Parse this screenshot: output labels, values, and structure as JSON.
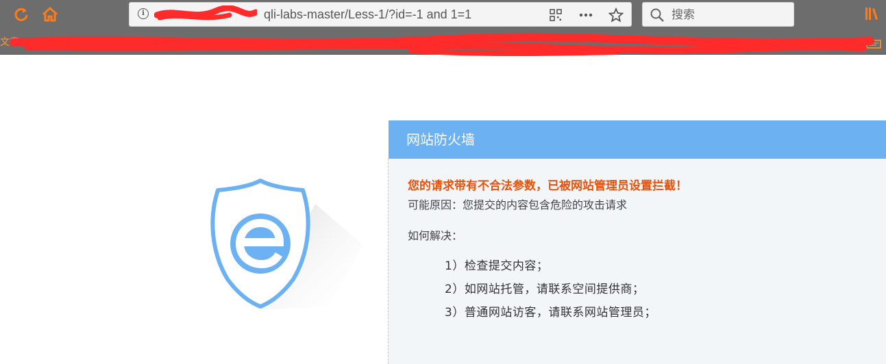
{
  "browser": {
    "url": "qli-labs-master/Less-1/?id=-1 and 1=1",
    "search_placeholder": "搜索",
    "bookmarks_left_label": "文章",
    "toolbar_icons": [
      "refresh-icon",
      "home-icon",
      "info-icon",
      "qr-code-icon",
      "more-icon",
      "star-icon",
      "search-icon",
      "library-icon"
    ],
    "accent_color": "#ff7b1a"
  },
  "firewall": {
    "title": "网站防火墙",
    "warning": "您的请求带有不合法参数，已被网站管理员设置拦截！",
    "reason": "可能原因：您提交的内容包含危险的攻击请求",
    "howto_label": "如何解决：",
    "steps": [
      "1）检查提交内容；",
      "2）如网站托管，请联系空间提供商；",
      "3）普通网站访客，请联系网站管理员；"
    ],
    "header_color": "#6cb1f2",
    "warning_color": "#e8520b",
    "shield_color": "#6cb1f2"
  }
}
